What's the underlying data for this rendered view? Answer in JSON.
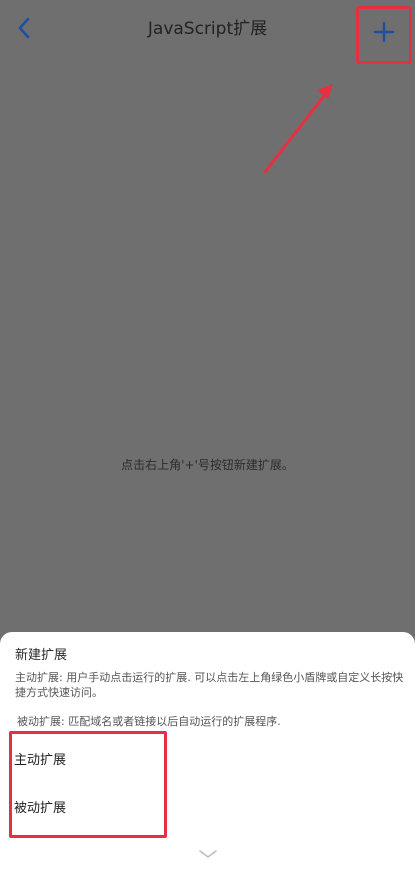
{
  "header": {
    "title": "JavaScript扩展",
    "back_icon": "chevron-left-icon",
    "add_icon": "plus-icon",
    "icon_color": "#1d4fa3"
  },
  "empty_state": {
    "hint": "点击右上角'+'号按钮新建扩展。"
  },
  "sheet": {
    "title": "新建扩展",
    "description_active": "主动扩展: 用户手动点击运行的扩展. 可以点击左上角绿色小盾牌或自定义长按快捷方式快速访问。",
    "description_passive": "被动扩展: 匹配域名或者链接以后自动运行的扩展程序.",
    "options": [
      {
        "label": "主动扩展"
      },
      {
        "label": "被动扩展"
      }
    ],
    "collapse_icon": "chevron-down-icon"
  },
  "annotation_color": "#e53042"
}
